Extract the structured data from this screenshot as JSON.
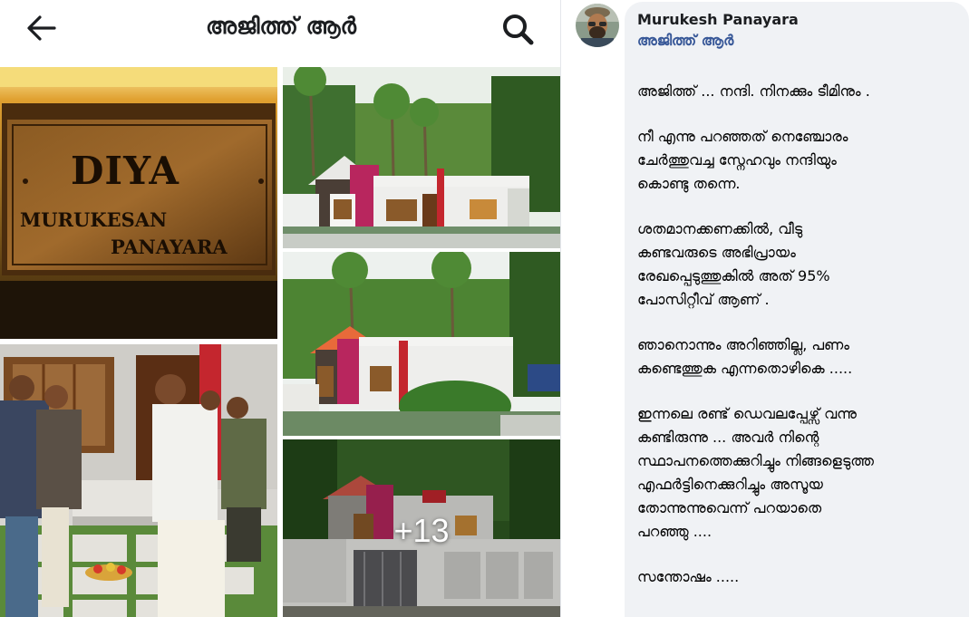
{
  "header": {
    "title": "അജിത്ത് ആർ",
    "back_icon": "back-arrow-icon",
    "search_icon": "search-icon"
  },
  "gallery": {
    "sign": {
      "line1": "DIYA",
      "line2": "MURUKESAN",
      "line3": "PANAYARA"
    },
    "more_label": "+13"
  },
  "post": {
    "author": "Murukesh Panayara",
    "tagged": "അജിത്ത് ആർ",
    "paragraphs": [
      "അജിത്ത് ... നന്ദി. നിനക്കും ടീമിനും .",
      "നീ എന്നു പറഞ്ഞത് നെഞ്ചോരം\nചേർത്തുവച്ച സ്നേഹവും നന്ദിയും\nകൊണ്ടു തന്നെ.",
      "ശതമാനക്കണക്കിൽ, വീടു\nകണ്ടവരുടെ അഭിപ്രായം\nരേഖപ്പെടുത്തുകിൽ അത് 95%\nപോസിറ്റീവ് ആണ് .",
      "ഞാനൊന്നും അറിഞ്ഞില്ല, പണം\nകണ്ടെത്തുക എന്നതൊഴികെ .....",
      "ഇന്നലെ രണ്ട് ഡെവലപ്പേഴ്സ് വന്നു\nകണ്ടിരുന്നു ... അവർ നിന്റെ\nസ്ഥാപനത്തെക്കുറിച്ചും നിങ്ങളെടുത്ത\nഎഫർട്ടിനെക്കുറിച്ചും അസൂയ\nതോന്നുന്നുവെന്ന് പറയാതെ\nപറഞ്ഞു ....",
      "സന്തോഷം ....."
    ]
  },
  "colors": {
    "link": "#385898",
    "bubble": "#f0f2f5",
    "text": "#050505"
  }
}
